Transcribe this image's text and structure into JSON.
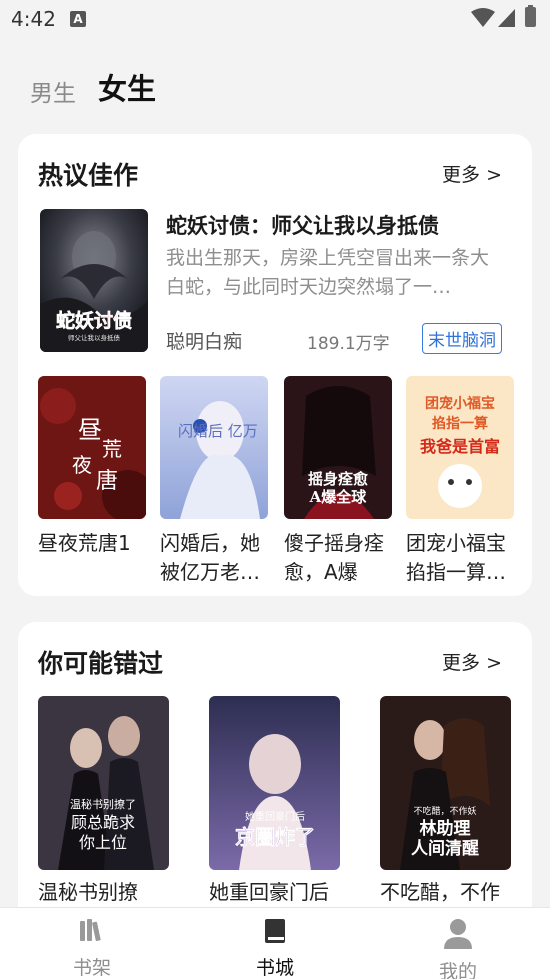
{
  "status_bar": {
    "time": "4:42",
    "notif_icon_letter": "A"
  },
  "gender_tabs": [
    {
      "label": "男生",
      "active": false
    },
    {
      "label": "女生",
      "active": true
    }
  ],
  "section_hot": {
    "title": "热议佳作",
    "more": "更多 >",
    "featured": {
      "title": "蛇妖讨债：师父让我以身抵债",
      "description": "我出生那天，房梁上凭空冒出来一条大白蛇，与此同时天边突然塌了一…",
      "author": "聪明白痴",
      "words": "189.1万字",
      "tag": "末世脑洞",
      "cover_text": "蛇妖讨债",
      "cover_sub": "师父让我以身抵债"
    },
    "books": [
      {
        "title": "昼夜荒唐1",
        "cover_text": "昼夜荒唐"
      },
      {
        "title": "闪婚后，她被亿万老…",
        "cover_text": "闪婚后 亿万"
      },
      {
        "title": "傻子摇身痊愈，A爆全…",
        "cover_text": "摇身痊愈 A爆全球"
      },
      {
        "title": "团宠小福宝掐指一算…",
        "cover_text": "团宠小福宝 掐指一算 我爸是首富"
      }
    ]
  },
  "section_miss": {
    "title": "你可能错过",
    "more": "更多 >",
    "books": [
      {
        "title": "温秘书别撩",
        "cover_text": "顾总跪求你上位"
      },
      {
        "title": "她重回豪门后",
        "cover_text": "京圈炸了"
      },
      {
        "title": "不吃醋，不作",
        "cover_text": "林助理人间清醒"
      }
    ]
  },
  "bottom_nav": [
    {
      "label": "书架",
      "icon": "bookshelf-icon",
      "active": false
    },
    {
      "label": "书城",
      "icon": "book-icon",
      "active": true
    },
    {
      "label": "我的",
      "icon": "person-icon",
      "active": false
    }
  ],
  "colors": {
    "accent_tag": "#2f73d9",
    "background": "#f3f3f3",
    "card": "#ffffff"
  }
}
